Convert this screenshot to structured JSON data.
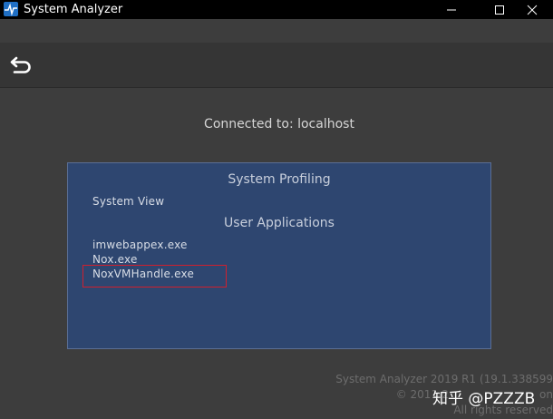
{
  "window": {
    "title": "System Analyzer",
    "icon": "app-icon"
  },
  "toolbar": {
    "back_icon": "back-arrow-icon"
  },
  "connection": {
    "text": "Connected to: localhost"
  },
  "panel": {
    "system_profiling_title": "System Profiling",
    "system_view_label": "System View",
    "user_applications_title": "User Applications",
    "applications": [
      "imwebappex.exe",
      "Nox.exe",
      "NoxVMHandle.exe"
    ]
  },
  "footer": {
    "version": "System Analyzer 2019 R1 (19.1.338599",
    "copyright": "© 2011-2",
    "copyright_tail": "on",
    "rights": "All rights reserved"
  },
  "watermark": {
    "text": "知乎 @PZZZB"
  },
  "colors": {
    "panel_bg": "#2e4670",
    "highlight": "#d01f2e",
    "window_bg": "#3d3d3d"
  }
}
